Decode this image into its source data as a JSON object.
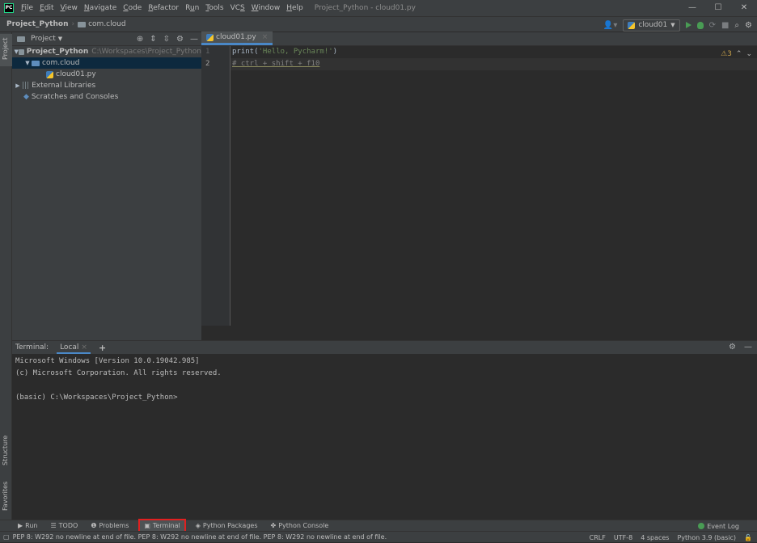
{
  "titlebar": {
    "app_icon": "PC",
    "menu": [
      "File",
      "Edit",
      "View",
      "Navigate",
      "Code",
      "Refactor",
      "Run",
      "Tools",
      "VCS",
      "Window",
      "Help"
    ],
    "menu_mnemonics": [
      "F",
      "E",
      "V",
      "N",
      "C",
      "R",
      "u",
      "T",
      "S",
      "W",
      "H"
    ],
    "window_title": "Project_Python - cloud01.py",
    "minimize": "—",
    "maximize": "☐",
    "close": "✕"
  },
  "navbar": {
    "project": "Project_Python",
    "folder": "com.cloud",
    "run_config": "cloud01"
  },
  "left_tool_tabs": {
    "project": "Project",
    "structure": "Structure",
    "favorites": "Favorites"
  },
  "project_panel": {
    "title": "Project",
    "tree": [
      {
        "label": "Project_Python",
        "path": "C:\\Workspaces\\Project_Python"
      },
      {
        "label": "com.cloud"
      },
      {
        "label": "cloud01.py"
      },
      {
        "label": "External Libraries"
      },
      {
        "label": "Scratches and Consoles"
      }
    ]
  },
  "editor": {
    "tab": "cloud01.py",
    "line_numbers": [
      "1",
      "2"
    ],
    "code": {
      "line1_fn": "print(",
      "line1_str": "'Hello, Pycharm!'",
      "line1_end": ")",
      "line2": "# ctrl + shift + f10"
    },
    "warnings_count": "3"
  },
  "terminal": {
    "label": "Terminal:",
    "tab": "Local",
    "lines": [
      "Microsoft Windows [Version 10.0.19042.985]",
      "(c) Microsoft Corporation. All rights reserved.",
      "",
      "(basic) C:\\Workspaces\\Project_Python>"
    ]
  },
  "bottom_tabs": [
    "Run",
    "TODO",
    "Problems",
    "Terminal",
    "Python Packages",
    "Python Console"
  ],
  "event_log": "Event Log",
  "status": {
    "message": "PEP 8: W292 no newline at end of file. PEP 8: W292 no newline at end of file. PEP 8: W292 no newline at end of file.",
    "line_sep": "CRLF",
    "encoding": "UTF-8",
    "indent": "4 spaces",
    "interpreter": "Python 3.9 (basic)"
  },
  "colors": {
    "accent": "#4a88c7",
    "highlight_box": "#e02020",
    "selection": "#0d293e"
  }
}
